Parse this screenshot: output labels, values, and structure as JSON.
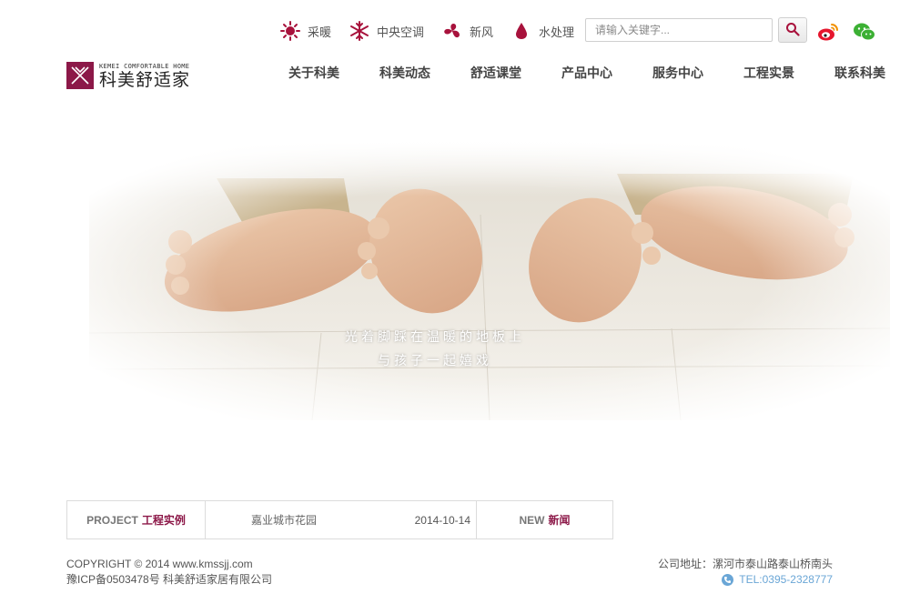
{
  "categories": [
    {
      "label": "采暖",
      "icon": "sun-icon",
      "color": "#a8123c"
    },
    {
      "label": "中央空调",
      "icon": "snowflake-icon",
      "color": "#a8123c"
    },
    {
      "label": "新风",
      "icon": "fan-icon",
      "color": "#a8123c"
    },
    {
      "label": "水处理",
      "icon": "water-drop-icon",
      "color": "#a8123c"
    }
  ],
  "search": {
    "placeholder": "请输入关键字..."
  },
  "social": [
    "weibo-icon",
    "wechat-icon"
  ],
  "logo": {
    "en": "KEMEI COMFORTABLE HOME",
    "cn": "科美舒适家",
    "color": "#8c1848"
  },
  "nav": [
    "关于科美",
    "科美动态",
    "舒适课堂",
    "产品中心",
    "服务中心",
    "工程实景",
    "联系科美"
  ],
  "hero": {
    "caption_line1": "光着脚踩在温暖的地板上",
    "caption_line2": "与孩子一起嬉戏"
  },
  "infobar": {
    "project_en": "PROJECT",
    "project_cn": "工程实例",
    "item_title": "嘉业城市花园",
    "item_date": "2014-10-14",
    "news_en": "NEW",
    "news_cn": "新闻"
  },
  "footer": {
    "copyright": "COPYRIGHT © 2014 www.kmssjj.com",
    "icp": "豫ICP备0503478号 科美舒适家居有限公司",
    "address": "公司地址：漯河市泰山路泰山桥南头",
    "tel": "TEL:0395-2328777"
  }
}
